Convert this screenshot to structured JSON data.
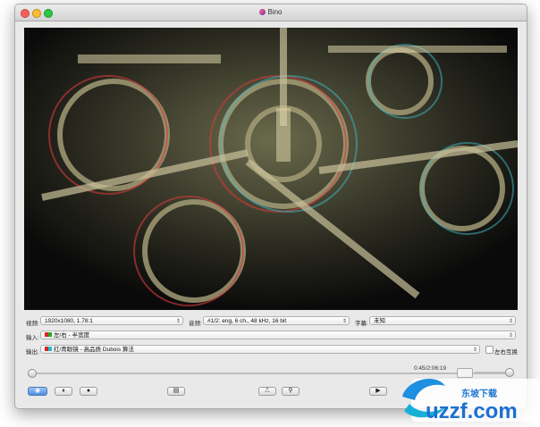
{
  "window": {
    "title": "Bino"
  },
  "video": {
    "left_controls": {
      "video_label": "视频:",
      "video_value": "1920x1080, 1.78:1",
      "audio_label": "音频:",
      "audio_value": "#1/2: eng, 6 ch., 48 kHz, 16 bit",
      "subtitle_label": "字幕:",
      "subtitle_value": "未知"
    },
    "input_label": "输入:",
    "input_value": "左/右 - 半宽度",
    "output_label": "输出:",
    "output_value": "红/青眼镜 - 高品质 Dubois 算法",
    "swap_label": "左右互换"
  },
  "playback": {
    "time": "0:45/2:06:19",
    "progress": 0.006,
    "volume": 0.9
  },
  "watermark": {
    "brand": "uzzf.com",
    "tagline": "东坡下载"
  },
  "icons": {
    "fullscreen": "fullscreen-icon",
    "pause": "pause-icon",
    "stop": "stop-icon",
    "play": "play-icon",
    "playlist": "playlist-icon",
    "loop": "loop-icon",
    "settings": "settings-icon"
  }
}
